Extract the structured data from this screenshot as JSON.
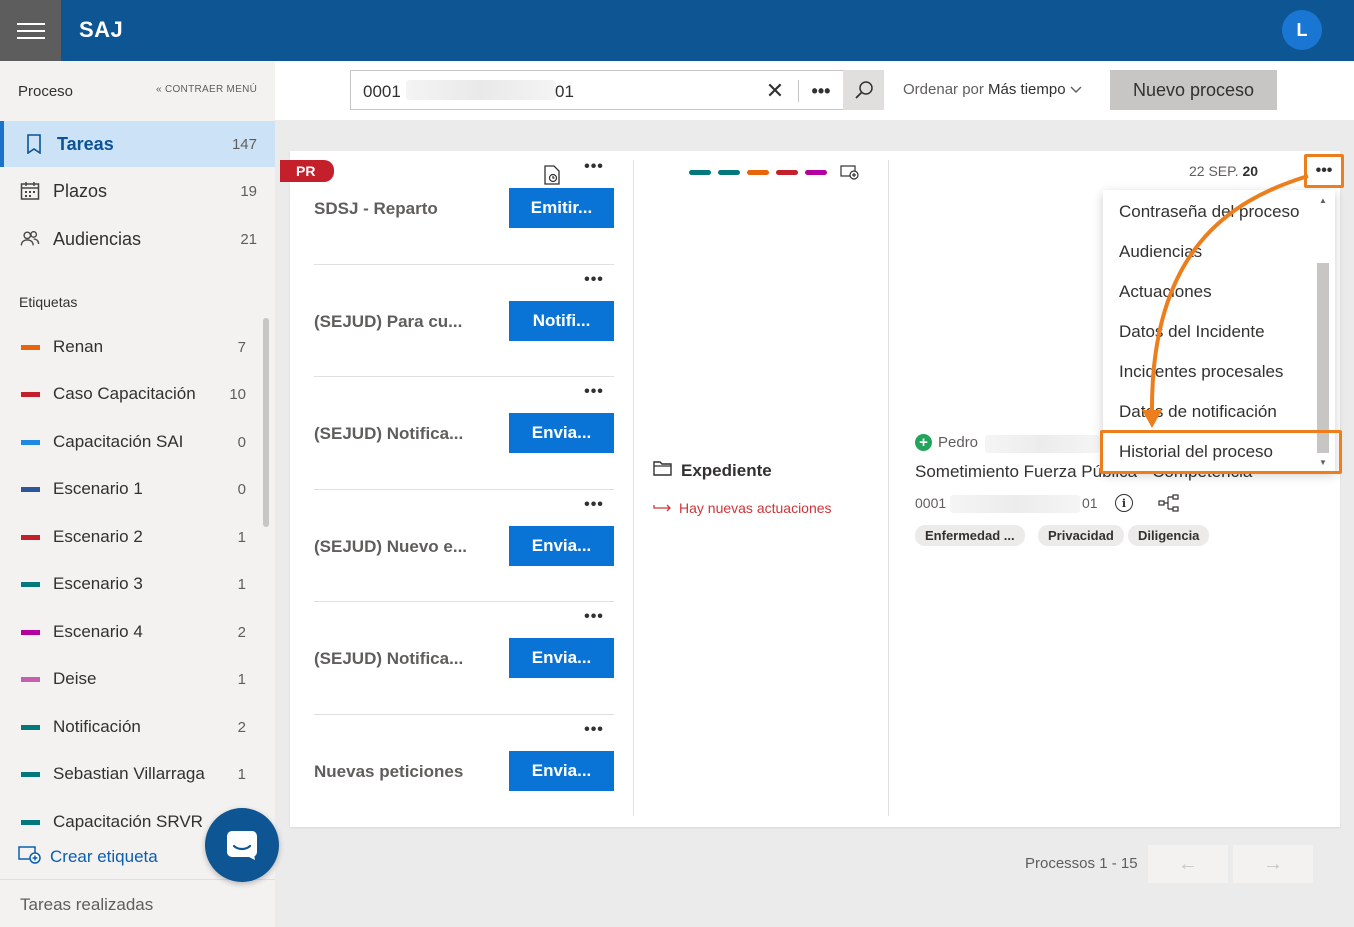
{
  "app": {
    "title": "SAJ",
    "user_initial": "L"
  },
  "sidebar": {
    "heading": "Proceso",
    "collapse_label": "CONTRAER MENÚ",
    "nav": [
      {
        "label": "Tareas",
        "count": "147",
        "icon": "book-icon"
      },
      {
        "label": "Plazos",
        "count": "19",
        "icon": "calendar-icon"
      },
      {
        "label": "Audiencias",
        "count": "21",
        "icon": "people-icon"
      }
    ],
    "tags_heading": "Etiquetas",
    "tags": [
      {
        "label": "Renan",
        "count": "7",
        "color": "#e8630a"
      },
      {
        "label": "Caso Capacitación",
        "count": "10",
        "color": "#c4202c"
      },
      {
        "label": "Capacitación SAI",
        "count": "0",
        "color": "#1e88e5"
      },
      {
        "label": "Escenario 1",
        "count": "0",
        "color": "#2b579a"
      },
      {
        "label": "Escenario 2",
        "count": "1",
        "color": "#c4202c"
      },
      {
        "label": "Escenario 3",
        "count": "1",
        "color": "#03787c"
      },
      {
        "label": "Escenario 4",
        "count": "2",
        "color": "#b4009e"
      },
      {
        "label": "Deise",
        "count": "1",
        "color": "#c560b0"
      },
      {
        "label": "Notificación",
        "count": "2",
        "color": "#03787c"
      },
      {
        "label": "Sebastian Villarraga",
        "count": "1",
        "color": "#03787c"
      },
      {
        "label": "Capacitación SRVR",
        "count": "",
        "color": "#03787c"
      }
    ],
    "create_tag": "Crear etiqueta",
    "done_tasks": "Tareas realizadas"
  },
  "search": {
    "value_start": "0001",
    "value_end": "01"
  },
  "sort": {
    "prefix": "Ordenar por",
    "value": "Más tiempo"
  },
  "new_process": "Nuevo proceso",
  "card": {
    "badge": "PR",
    "tasks": [
      {
        "title": "SDSJ - Reparto",
        "button": "Emitir..."
      },
      {
        "title": "(SEJUD) Para cu...",
        "button": "Notifi..."
      },
      {
        "title": "(SEJUD) Notifica...",
        "button": "Envia..."
      },
      {
        "title": "(SEJUD) Nuevo e...",
        "button": "Envia..."
      },
      {
        "title": "(SEJUD) Notifica...",
        "button": "Envia..."
      },
      {
        "title": "Nuevas peticiones",
        "button": "Envia..."
      }
    ],
    "tag_colors": [
      "#03787c",
      "#03787c",
      "#e8630a",
      "#c4202c",
      "#b4009e"
    ],
    "expediente": "Expediente",
    "new_actions": "Hay nuevas actuaciones",
    "date_prefix": "22 SEP.",
    "date_bold": "20",
    "person": "Pedro",
    "process_title": "Sometimiento Fuerza Pública - Competencia",
    "process_num_start": "0001",
    "process_num_end": "01",
    "chips": [
      "Enfermedad ...",
      "Privacidad",
      "Diligencia"
    ]
  },
  "menu": {
    "items": [
      "Contraseña del proceso",
      "Audiencias",
      "Actuaciones",
      "Datos del Incidente",
      "Incidentes procesales",
      "Datos de notificación",
      "Historial del proceso"
    ]
  },
  "pagination": {
    "label": "Processos 1 - 15"
  },
  "accent": {
    "topbar": "#0e5594",
    "highlight": "#ec7e1d",
    "button": "#0a74d6"
  }
}
